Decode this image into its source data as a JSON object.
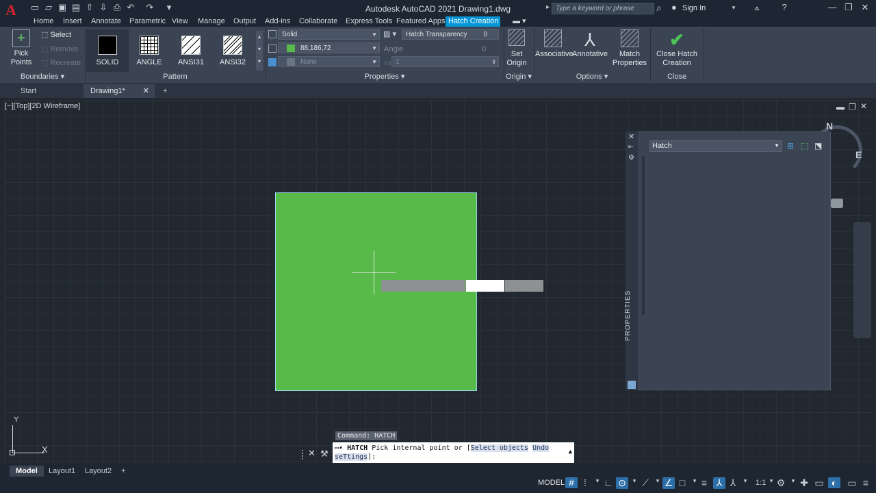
{
  "app": {
    "title": "Autodesk AutoCAD 2021   Drawing1.dwg",
    "logo": "A"
  },
  "search": {
    "placeholder": "Type a keyword or phrase"
  },
  "account": {
    "sign_in": "Sign In"
  },
  "ribbon_tabs": [
    "Home",
    "Insert",
    "Annotate",
    "Parametric",
    "View",
    "Manage",
    "Output",
    "Add-ins",
    "Collaborate",
    "Express Tools",
    "Featured Apps",
    "Hatch Creation"
  ],
  "ribbon": {
    "boundaries": {
      "pick_points": "Pick Points",
      "select": "Select",
      "remove": "Remove",
      "recreate": "Recreate",
      "label": "Boundaries"
    },
    "pattern": {
      "items": [
        "SOLID",
        "ANGLE",
        "ANSI31",
        "ANSI32"
      ],
      "label": "Pattern"
    },
    "properties": {
      "type": "Solid",
      "color": "88,186,72",
      "background": "None",
      "transparency_label": "Hatch Transparency",
      "transparency_value": "0",
      "angle_label": "Angle",
      "angle_value": "0",
      "scale_value": "1",
      "label": "Properties"
    },
    "origin": {
      "set_origin": "Set Origin",
      "label": "Origin"
    },
    "options": {
      "associative": "Associative",
      "annotative": "Annotative",
      "match": "Match Properties",
      "label": "Options"
    },
    "close": {
      "button": "Close Hatch Creation",
      "label": "Close"
    }
  },
  "doc_tabs": {
    "start": "Start",
    "drawing": "Drawing1*"
  },
  "viewport": {
    "label": "[−][Top][2D Wireframe]"
  },
  "properties_palette": {
    "title": "PROPERTIES",
    "selection": "Hatch"
  },
  "compass": {
    "n": "N",
    "e": "E"
  },
  "command": {
    "history": "Command: HATCH",
    "cmd": "HATCH",
    "prompt": "Pick internal point or [",
    "opt1": "Select objects",
    "opt2": "Undo",
    "opt3": "seTtings",
    "end": "]:"
  },
  "ucs": {
    "x": "X",
    "y": "Y"
  },
  "layout_tabs": [
    "Model",
    "Layout1",
    "Layout2"
  ],
  "status": {
    "model": "MODEL",
    "scale": "1:1"
  },
  "colors": {
    "hatch": "#58BA48",
    "accent": "#0696D7"
  }
}
